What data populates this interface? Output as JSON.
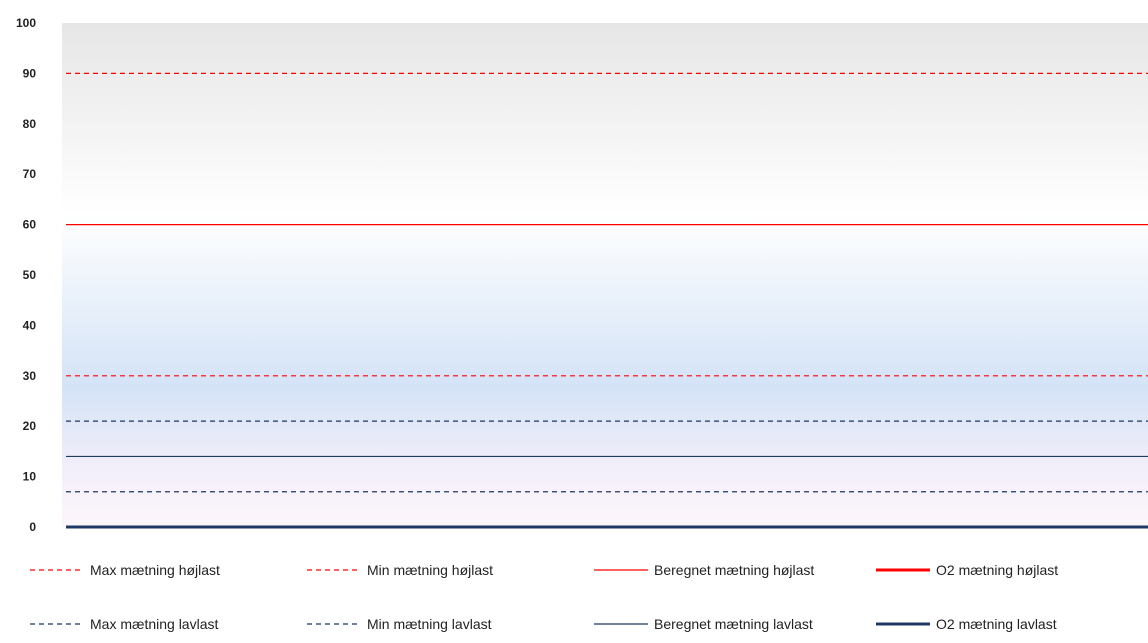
{
  "chart_data": {
    "type": "line",
    "title": "",
    "xlabel": "",
    "ylabel": "",
    "ylim": [
      0,
      100
    ],
    "yticks": [
      0,
      10,
      20,
      30,
      40,
      50,
      60,
      70,
      80,
      90,
      100
    ],
    "grid": false,
    "legend_position": "bottom",
    "series": [
      {
        "name": "Max mætning højlast",
        "value": 90,
        "color": "#ff0000",
        "style": "dashed",
        "weight": "thin"
      },
      {
        "name": "Min mætning højlast",
        "value": 30,
        "color": "#ff0000",
        "style": "dashed",
        "weight": "thin"
      },
      {
        "name": "Beregnet mætning højlast",
        "value": 60,
        "color": "#ff0000",
        "style": "solid",
        "weight": "thin"
      },
      {
        "name": "O2 mætning højlast",
        "value": 0,
        "color": "#ff0000",
        "style": "solid",
        "weight": "thick"
      },
      {
        "name": "Max mætning lavlast",
        "value": 21,
        "color": "#1f3864",
        "style": "dashed",
        "weight": "thin"
      },
      {
        "name": "Min mætning lavlast",
        "value": 7,
        "color": "#1f3864",
        "style": "dashed",
        "weight": "thin"
      },
      {
        "name": "Beregnet mætning lavlast",
        "value": 14,
        "color": "#1f3864",
        "style": "solid",
        "weight": "thin"
      },
      {
        "name": "O2 mætning lavlast",
        "value": 0,
        "color": "#1f3864",
        "style": "solid",
        "weight": "thick"
      }
    ]
  }
}
